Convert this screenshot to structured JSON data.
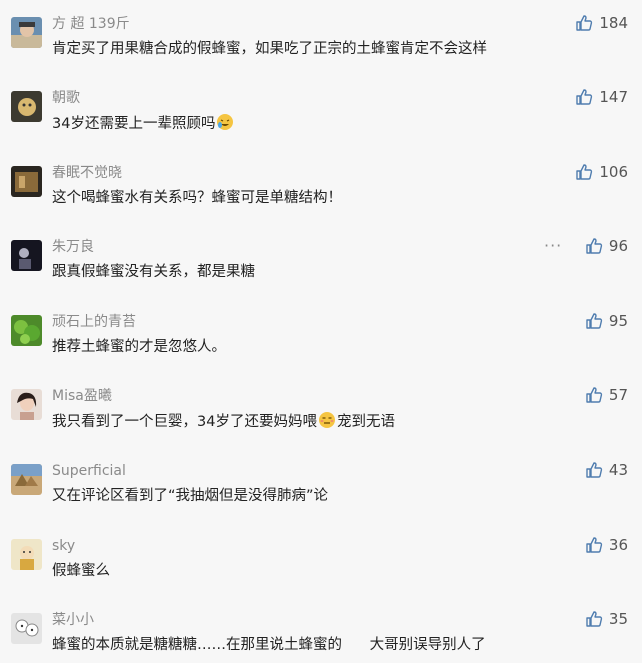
{
  "comments": [
    {
      "name": "方 超  139斤",
      "text": "肯定买了用果糖合成的假蜂蜜，如果吃了正宗的土蜂蜜肯定不会这样",
      "likes": "184"
    },
    {
      "name": "朝歌",
      "text": "34岁还需要上一辈照顾吗",
      "likes": "147"
    },
    {
      "name": "春眠不觉晓",
      "text": "这个喝蜂蜜水有关系吗？蜂蜜可是单糖结构！",
      "likes": "106"
    },
    {
      "name": "朱万良",
      "text": "跟真假蜂蜜没有关系，都是果糖",
      "likes": "96",
      "more": "···"
    },
    {
      "name": "顽石上的青苔",
      "text": "推荐土蜂蜜的才是忽悠人。",
      "likes": "95"
    },
    {
      "name": "Misa盈曦",
      "text_a": "我只看到了一个巨婴，34岁了还要妈妈喂",
      "text_b": "宠到无语",
      "likes": "57"
    },
    {
      "name": "Superficial",
      "text": "又在评论区看到了“我抽烟但是没得肺病”论",
      "likes": "43"
    },
    {
      "name": "sky",
      "text": "假蜂蜜么",
      "likes": "36"
    },
    {
      "name": "菜小小",
      "text": "蜂蜜的本质就是糖糖糖……在那里说土蜂蜜的      大哥别误导别人了",
      "likes": "35"
    }
  ],
  "colors": {
    "accent": "#507daf",
    "name": "#8a8a8a",
    "text": "#222222"
  },
  "icons": {
    "like": "thumbs-up-icon",
    "more": "ellipsis-icon",
    "emoji": "face-emoji-icon"
  }
}
